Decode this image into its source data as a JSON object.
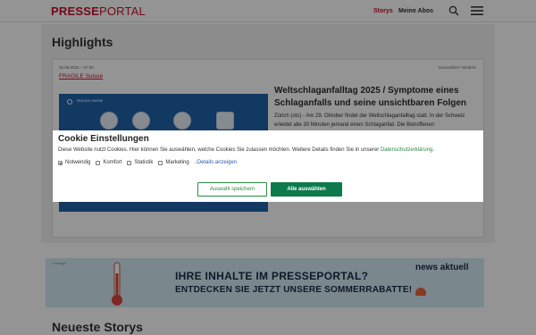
{
  "header": {
    "logo_bold": "PRESSE",
    "logo_normal": "PORTAL",
    "nav_storys": "Storys",
    "nav_abos": "Meine Abos",
    "search_icon": "search-icon",
    "menu_icon": "hamburger-menu-icon"
  },
  "highlights": {
    "title": "Highlights",
    "card": {
      "date": "30.09.2025 – 07:00",
      "category": "Gesundheit / Medizin",
      "company": "FRAGILE Suisse",
      "image_brand": "FRAGILE SUISSE",
      "headline": "Weltschlaganfalltag 2025 / Symptome eines Schlaganfalls und seine unsichtbaren Folgen",
      "body": "Zürich (ots) - Am 29. Oktober findet der Weltschlaganfalltag statt. In der Schweiz erleidet alle 30 Minuten jemand einen Schlaganfall. Die Betroffenen"
    }
  },
  "ad": {
    "label": "Anzeige",
    "line1": "IHRE INHALTE IM PRESSEPORTAL?",
    "line2": "ENTDECKEN SIE JETZT UNSERE SOMMERRABATTE!",
    "brand": "news aktuell"
  },
  "neueste": {
    "title": "Neueste Storys"
  },
  "cookie": {
    "title": "Cookie Einstellungen",
    "text": "Diese Website nutzt Cookies. Hier können Sie auswählen, welche Cookies Sie zulassen möchten. Weitere Details finden Sie in unserer ",
    "link": "Datenschutzerklärung",
    "text_end": ".",
    "options": [
      {
        "label": "Notwendig",
        "checked": true
      },
      {
        "label": "Komfort",
        "checked": false
      },
      {
        "label": "Statistik",
        "checked": false
      },
      {
        "label": "Marketing",
        "checked": false
      }
    ],
    "details": "Details anzeigen",
    "btn_select": "Auswahl speichern",
    "btn_all": "Alle auswählen"
  },
  "colors": {
    "brand_red": "#c8102e",
    "cookie_green": "#0e7a4c",
    "overlay": "rgba(0,0,0,0.42)"
  }
}
